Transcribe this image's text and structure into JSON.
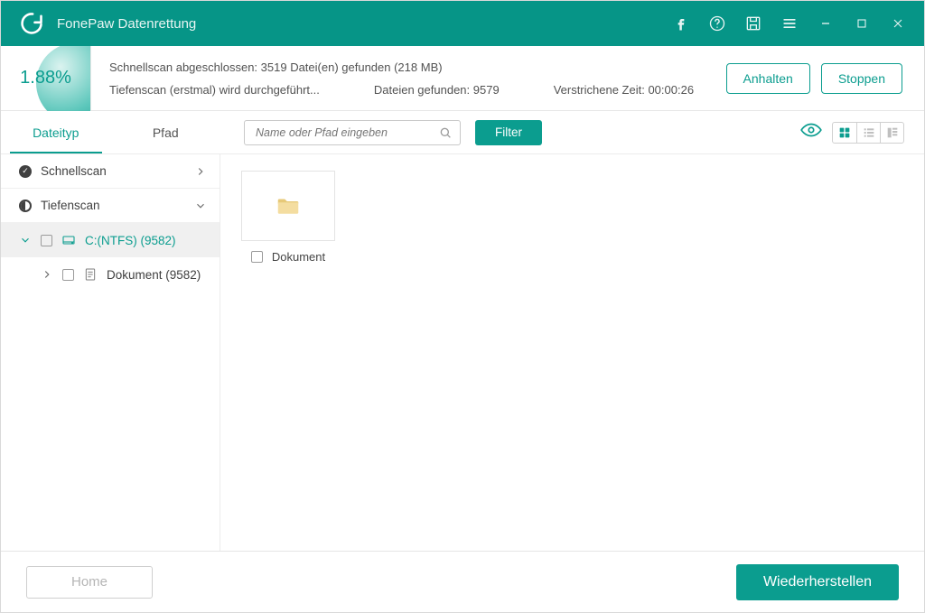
{
  "titlebar": {
    "app_name": "FonePaw Datenrettung"
  },
  "progress": {
    "percent": "1.88%"
  },
  "status": {
    "line1": "Schnellscan abgeschlossen: 3519 Datei(en) gefunden (218 MB)",
    "line2_left": "Tiefenscan (erstmal) wird durchgeführt...",
    "files_found_label": "Dateien gefunden: 9579",
    "elapsed_label": "Verstrichene Zeit: 00:00:26",
    "pause": "Anhalten",
    "stop": "Stoppen"
  },
  "toolbar": {
    "tab_type": "Dateityp",
    "tab_path": "Pfad",
    "search_placeholder": "Name oder Pfad eingeben",
    "filter": "Filter"
  },
  "tree": {
    "quickscan": "Schnellscan",
    "deepscan": "Tiefenscan",
    "drive": "C:(NTFS) (9582)",
    "document": "Dokument (9582)"
  },
  "content": {
    "folder1": "Dokument"
  },
  "footer": {
    "home": "Home",
    "recover": "Wiederherstellen"
  }
}
